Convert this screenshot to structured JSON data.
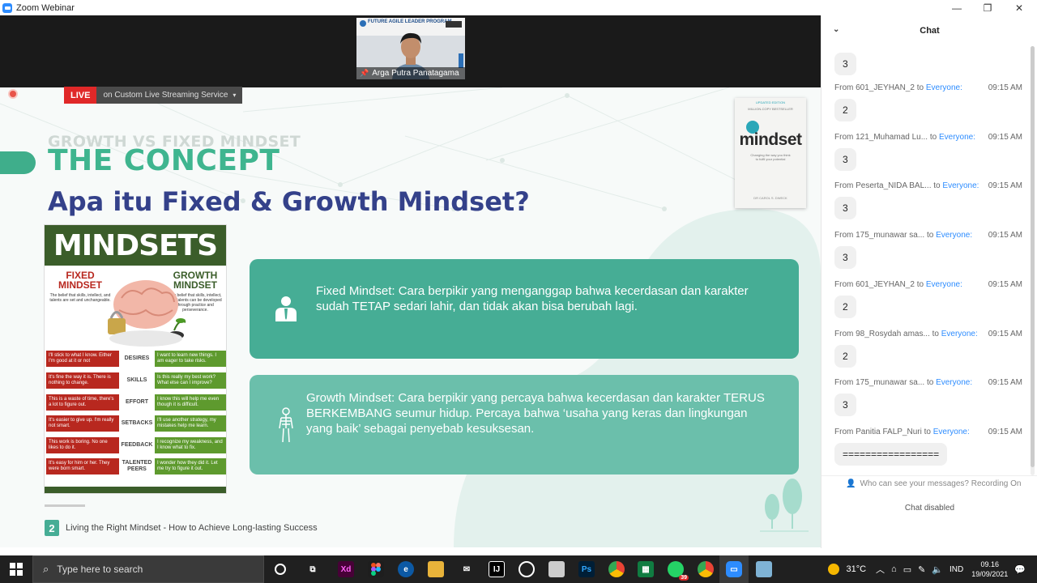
{
  "window": {
    "title": "Zoom Webinar"
  },
  "video": {
    "participant_name": "Arga Putra Panatagama",
    "banner_text": "FUTURE AGILE LEADER PROGRAM"
  },
  "streaming": {
    "live_label": "LIVE",
    "service_label": "on Custom Live Streaming Service"
  },
  "slide": {
    "kicker": "GROWTH VS FIXED MINDSET",
    "heading": "THE CONCEPT",
    "title": "Apa itu Fixed & Growth Mindset?",
    "book": {
      "edition": "UPDATED EDITION",
      "bestseller": "MILLION-COPY BESTSELLER",
      "title": "mindset",
      "subtitle": "Changing the way you think to fulfil your potential",
      "author": "DR CAROL S. DWECK"
    },
    "infographic": {
      "title": "MINDSETS",
      "fixed_heading": "FIXED MINDSET",
      "growth_heading": "GROWTH MINDSET",
      "fixed_desc": "The belief that skills, intellect, and talents are set and unchangeable.",
      "growth_desc": "The belief that skills, intellect, and talents can be developed through practice and perseverance.",
      "rows": [
        {
          "label": "DESIRES",
          "fixed": "I'll stick to what I know. Either I'm good at it or not",
          "growth": "I want to learn new things. I am eager to take risks."
        },
        {
          "label": "SKILLS",
          "fixed": "It's fine the way it is. There is nothing to change.",
          "growth": "Is this really my best work? What else can I improve?"
        },
        {
          "label": "EFFORT",
          "fixed": "This is a waste of time, there's a lot to figure out.",
          "growth": "I know this will help me even though it is difficult."
        },
        {
          "label": "SETBACKS",
          "fixed": "It's easier to give up. I'm really not smart.",
          "growth": "I'll use another strategy, my mistakes help me learn."
        },
        {
          "label": "FEEDBACK",
          "fixed": "This work is boring. No one likes to do it.",
          "growth": "I recognize my weakness, and I know what to fix."
        },
        {
          "label": "TALENTED PEERS",
          "fixed": "It's easy for him or her. They were born smart.",
          "growth": "I wonder how they did it. Let me try to figure it out."
        }
      ]
    },
    "cards": {
      "fixed": "Fixed Mindset: Cara berpikir yang menganggap bahwa kecerdasan dan karakter sudah TETAP sedari lahir, dan tidak akan bisa berubah lagi.",
      "growth": "Growth Mindset: Cara berpikir yang percaya bahwa kecerdasan dan karakter TERUS BERKEMBANG seumur hidup. Percaya bahwa ‘usaha yang keras dan lingkungan yang baik’ sebagai penyebab kesuksesan."
    },
    "footer": {
      "number": "2",
      "text": "Living the Right Mindset - How to Achieve Long-lasting Success"
    },
    "colors": {
      "green": "#46ad95",
      "light_green": "#6bbfab",
      "navy": "#34418a"
    }
  },
  "chat": {
    "header": "Chat",
    "first_bubble": "3",
    "messages": [
      {
        "from": "From 601_JEYHAN_2",
        "to_word": "to",
        "to": "Everyone:",
        "time": "09:15 AM",
        "text": "2"
      },
      {
        "from": "From 121_Muhamad Lu...",
        "to_word": "to",
        "to": "Everyone:",
        "time": "09:15 AM",
        "text": "3"
      },
      {
        "from": "From Peserta_NIDA BAL...",
        "to_word": "to",
        "to": "Everyone:",
        "time": "09:15 AM",
        "text": "3"
      },
      {
        "from": "From 175_munawar sa...",
        "to_word": "to",
        "to": "Everyone:",
        "time": "09:15 AM",
        "text": "3"
      },
      {
        "from": "From 601_JEYHAN_2",
        "to_word": "to",
        "to": "Everyone:",
        "time": "09:15 AM",
        "text": "2"
      },
      {
        "from": "From 98_Rosydah amas...",
        "to_word": "to",
        "to": "Everyone:",
        "time": "09:15 AM",
        "text": "2"
      },
      {
        "from": "From 175_munawar sa...",
        "to_word": "to",
        "to": "Everyone:",
        "time": "09:15 AM",
        "text": "3"
      },
      {
        "from": "From Panitia FALP_Nuri",
        "to_word": "to",
        "to": "Everyone:",
        "time": "09:15 AM",
        "text": "================="
      }
    ],
    "visibility_note": "Who can see your messages? Recording On",
    "disabled_text": "Chat disabled"
  },
  "taskbar": {
    "search_placeholder": "Type here to search",
    "weather": "31°C",
    "language": "IND",
    "time": "09.16",
    "date": "19/09/2021",
    "whatsapp_badge": "39"
  }
}
